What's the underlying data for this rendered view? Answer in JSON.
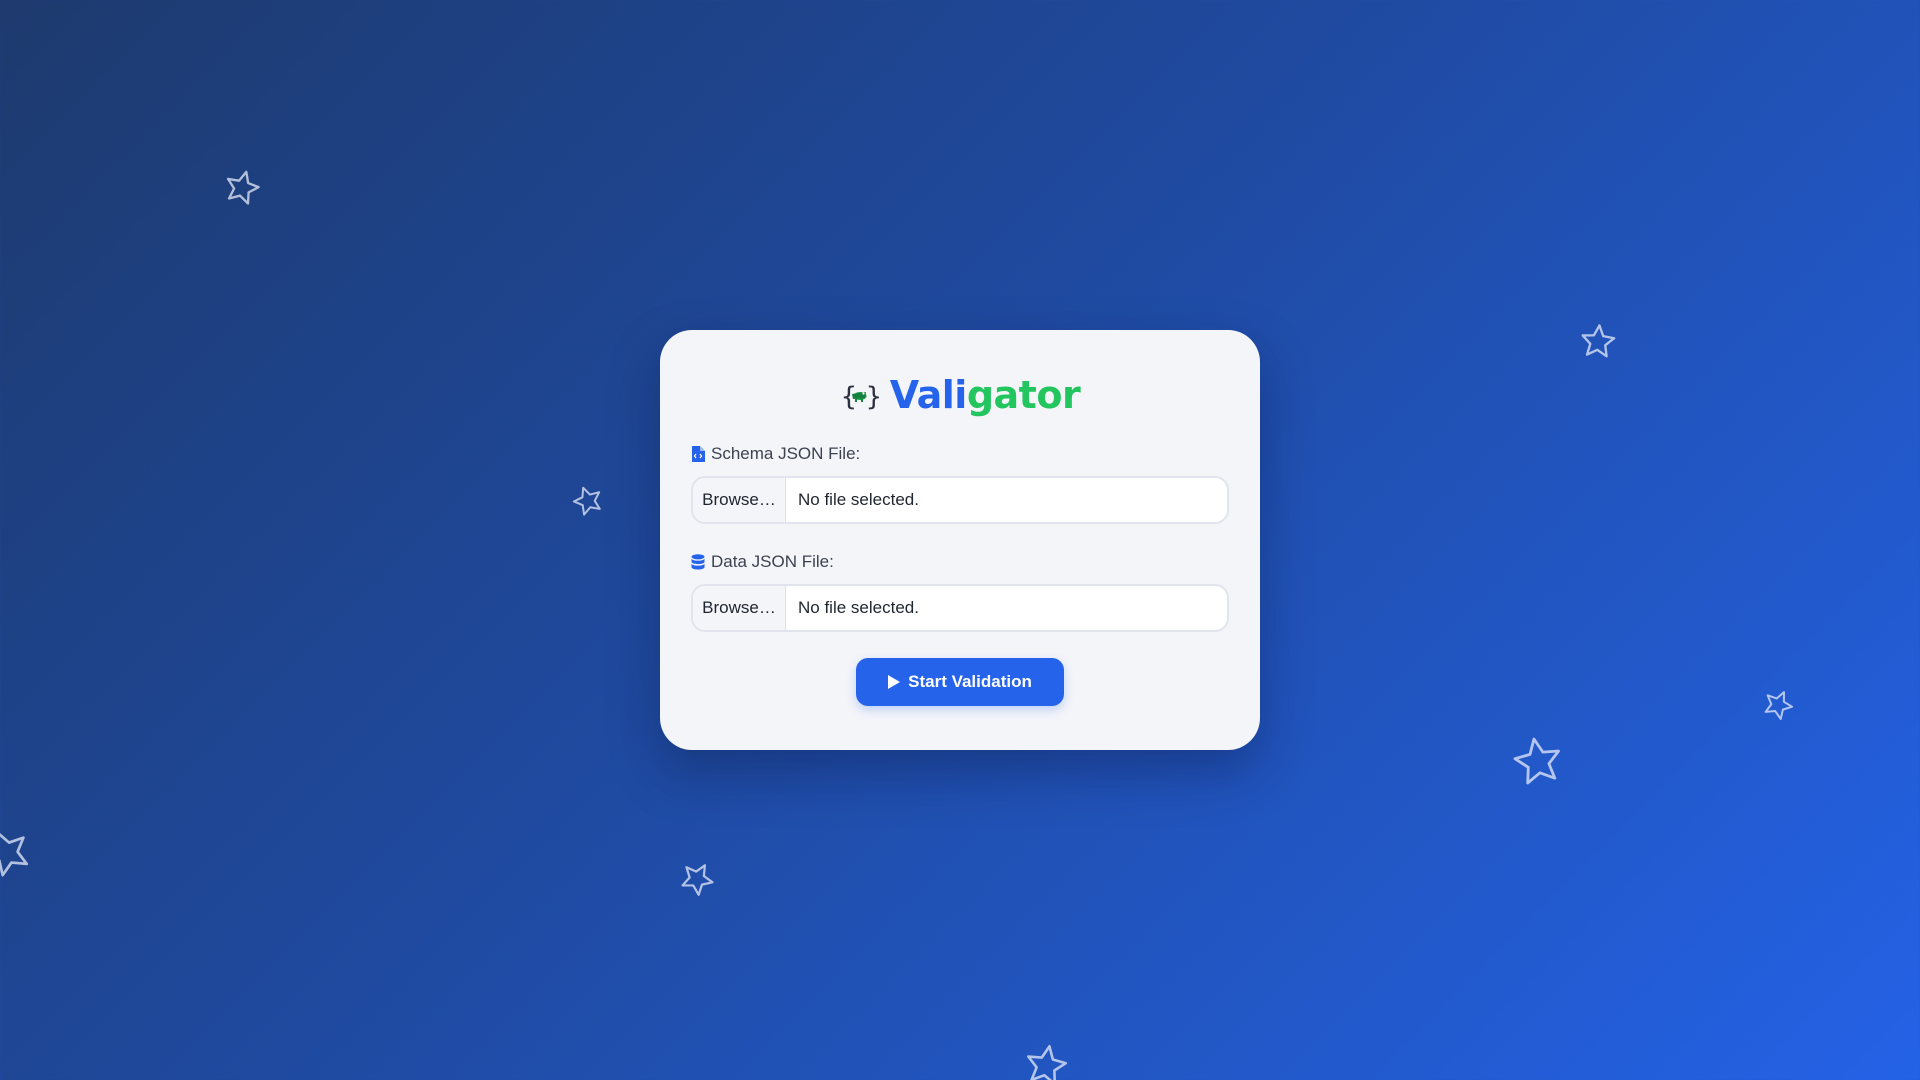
{
  "app": {
    "name_part1": "Vali",
    "name_part2": "gator",
    "logo_icon": "braces-gator-icon"
  },
  "form": {
    "schema": {
      "label": "Schema JSON File:",
      "icon": "file-code-icon",
      "browse_label": "Browse…",
      "status": "No file selected."
    },
    "data": {
      "label": "Data JSON File:",
      "icon": "database-icon",
      "browse_label": "Browse…",
      "status": "No file selected."
    },
    "submit": {
      "label": "Start Validation",
      "icon": "play-icon"
    }
  },
  "background": {
    "decoration_icon": "star-outline-icon"
  },
  "colors": {
    "accent": "#2563eb",
    "brand_green": "#22c55e",
    "card_bg": "#f4f5f9",
    "bg_start": "#1e3a6e",
    "bg_end": "#2462e6"
  }
}
